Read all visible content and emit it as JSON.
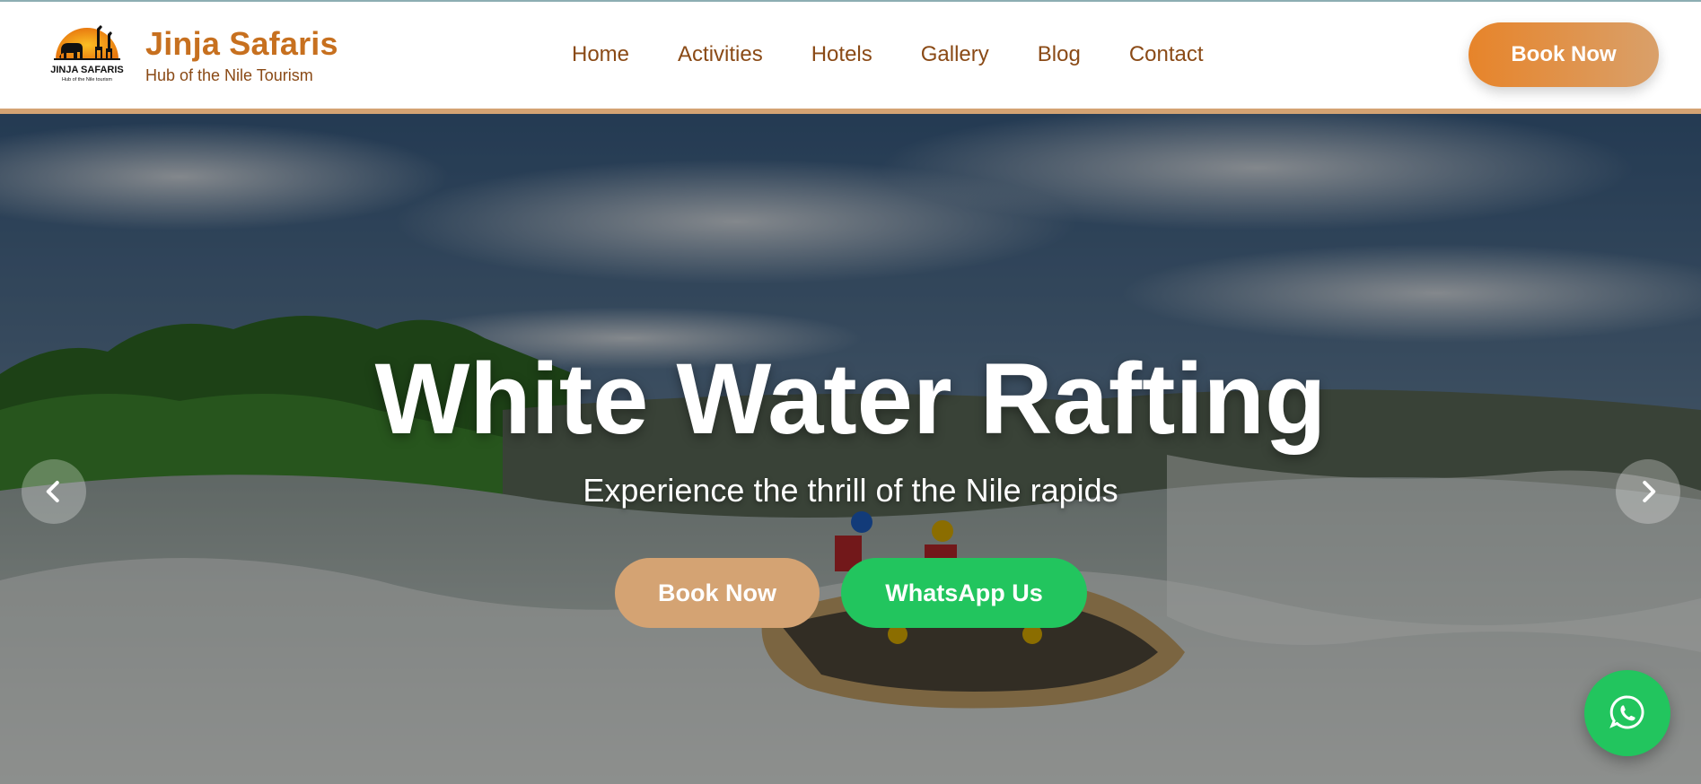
{
  "brand": {
    "name": "Jinja Safaris",
    "tagline": "Hub of the Nile Tourism",
    "logo_text": "JINJA SAFARIS",
    "logo_subtext": "Hub of the Nile tourism"
  },
  "nav": {
    "items": [
      {
        "label": "Home"
      },
      {
        "label": "Activities"
      },
      {
        "label": "Hotels"
      },
      {
        "label": "Gallery"
      },
      {
        "label": "Blog"
      },
      {
        "label": "Contact"
      }
    ],
    "cta_label": "Book Now"
  },
  "hero": {
    "title": "White Water Rafting",
    "subtitle": "Experience the thrill of the Nile rapids",
    "primary_button": "Book Now",
    "secondary_button": "WhatsApp Us",
    "prev_icon": "chevron-left-icon",
    "next_icon": "chevron-right-icon"
  },
  "floating": {
    "icon": "whatsapp-icon"
  },
  "colors": {
    "brand_orange": "#c7701f",
    "nav_text": "#8a4a16",
    "accent_tan": "#d4a373",
    "cta_gradient_start": "#e7842a",
    "whatsapp_green": "#22c55e"
  }
}
